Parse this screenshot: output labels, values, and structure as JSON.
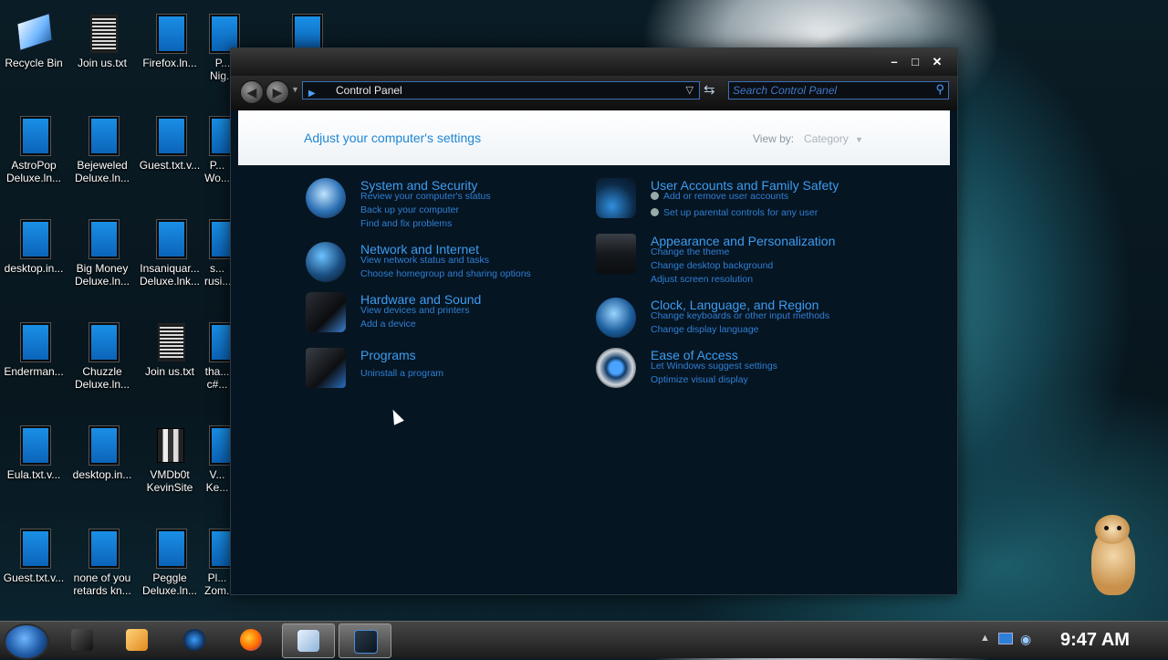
{
  "desktop": {
    "icons": [
      {
        "label": "Recycle Bin",
        "type": "bin"
      },
      {
        "label": "Join us.txt",
        "type": "txt"
      },
      {
        "label": "Firefox.ln...",
        "type": "blue"
      },
      {
        "label": "P... Nig...",
        "type": "blue"
      },
      {
        "label": "",
        "type": "blue"
      },
      {
        "label": "AstroPop Deluxe.ln...",
        "type": "blue"
      },
      {
        "label": "Bejeweled Deluxe.ln...",
        "type": "blue"
      },
      {
        "label": "Guest.txt.v...",
        "type": "blue"
      },
      {
        "label": "P... Wo...",
        "type": "blue"
      },
      {
        "label": "desktop.in...",
        "type": "blue"
      },
      {
        "label": "Big Money Deluxe.ln...",
        "type": "blue"
      },
      {
        "label": "Insaniquar... Deluxe.lnk...",
        "type": "blue"
      },
      {
        "label": "s... rusi...",
        "type": "blue"
      },
      {
        "label": "Enderman...",
        "type": "blue"
      },
      {
        "label": "Chuzzle Deluxe.ln...",
        "type": "blue"
      },
      {
        "label": "Join us.txt",
        "type": "txt"
      },
      {
        "label": "tha... c#...",
        "type": "blue"
      },
      {
        "label": "Eula.txt.v...",
        "type": "blue"
      },
      {
        "label": "desktop.in...",
        "type": "blue"
      },
      {
        "label": "VMDb0t KevinSite",
        "type": "folder"
      },
      {
        "label": "V... Ke...",
        "type": "blue"
      },
      {
        "label": "Guest.txt.v...",
        "type": "blue"
      },
      {
        "label": "none of you retards kn...",
        "type": "blue"
      },
      {
        "label": "Peggle Deluxe.ln...",
        "type": "blue"
      },
      {
        "label": "Pl... Zom...",
        "type": "blue"
      }
    ]
  },
  "window": {
    "address": "Control Panel",
    "search_placeholder": "Search Control Panel",
    "header_title": "Adjust your computer's settings",
    "view_by_label": "View by:",
    "view_by_value": "Category",
    "minimize": "–",
    "maximize": "□",
    "close": "✕",
    "categories": [
      {
        "title": "System and Security",
        "links": [
          "Review your computer's status",
          "Back up your computer",
          "Find and fix problems"
        ]
      },
      {
        "title": "Network and Internet",
        "links": [
          "View network status and tasks",
          "Choose homegroup and sharing options"
        ]
      },
      {
        "title": "Hardware and Sound",
        "links": [
          "View devices and printers",
          "Add a device"
        ]
      },
      {
        "title": "Programs",
        "links": [
          "Uninstall a program"
        ]
      },
      {
        "title": "User Accounts and Family Safety",
        "links": [
          "Add or remove user accounts",
          "Set up parental controls for any user"
        ]
      },
      {
        "title": "Appearance and Personalization",
        "links": [
          "Change the theme",
          "Change desktop background",
          "Adjust screen resolution"
        ]
      },
      {
        "title": "Clock, Language, and Region",
        "links": [
          "Change keyboards or other input methods",
          "Change display language"
        ]
      },
      {
        "title": "Ease of Access",
        "links": [
          "Let Windows suggest settings",
          "Optimize visual display"
        ]
      }
    ]
  },
  "taskbar": {
    "clock": "9:47 AM"
  },
  "colors": {
    "accent": "#3d9cf0",
    "link": "#2f7fd4",
    "window_bg": "#061522"
  }
}
